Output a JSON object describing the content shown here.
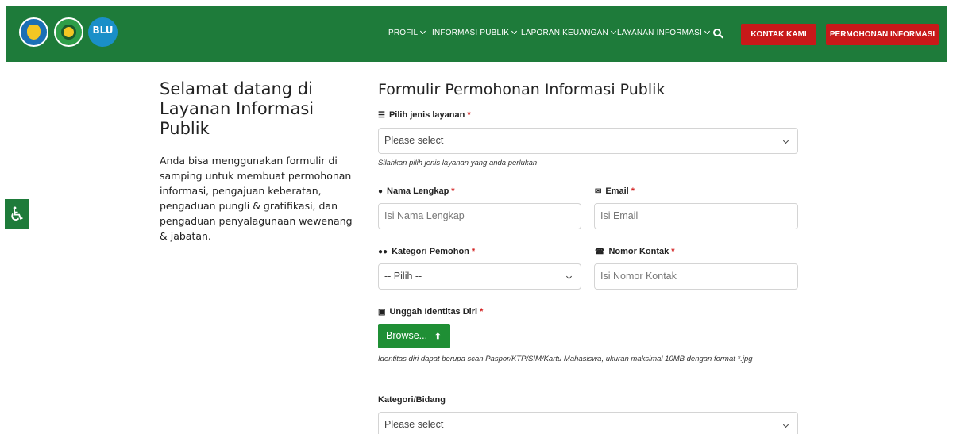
{
  "header": {
    "logos": [
      {
        "name": "kemendikbud-logo"
      },
      {
        "name": "institution-logo"
      },
      {
        "name": "blu-logo",
        "text": "BLU"
      }
    ],
    "nav": [
      {
        "label": "PROFIL"
      },
      {
        "label": "INFORMASI PUBLIK"
      },
      {
        "label": "LAPORAN KEUANGAN"
      },
      {
        "label": "LAYANAN INFORMASI"
      }
    ],
    "search_icon": "search-icon",
    "buttons": {
      "kontak": "KONTAK KAMI",
      "permohonan": "PERMOHONAN INFORMASI"
    },
    "brand_color": "#1e7b3a",
    "accent_color": "#c81919"
  },
  "accessibility": {
    "icon": "wheelchair-icon",
    "glyph": "♿"
  },
  "intro": {
    "title": "Selamat datang di Layanan Informasi Publik",
    "text": "Anda bisa menggunakan formulir di samping untuk membuat permohonan informasi, pengajuan keberatan, pengaduan pungli & gratifikasi, dan pengaduan penyalagunaan wewenang & jabatan."
  },
  "form": {
    "title": "Formulir Permohonan Informasi Publik",
    "required_mark": "*",
    "jenis_layanan": {
      "label": "Pilih jenis layanan",
      "icon": "database-icon",
      "value": "Please select",
      "help": "Silahkan pilih jenis layanan yang anda perlukan"
    },
    "nama": {
      "label": "Nama Lengkap",
      "icon": "user-icon",
      "placeholder": "Isi Nama Lengkap"
    },
    "email": {
      "label": "Email",
      "icon": "envelope-icon",
      "placeholder": "Isi Email"
    },
    "kategori_pemohon": {
      "label": "Kategori Pemohon",
      "icon": "users-icon",
      "value": "-- Pilih --"
    },
    "nomor_kontak": {
      "label": "Nomor Kontak",
      "icon": "phone-icon",
      "placeholder": "Isi Nomor Kontak"
    },
    "identitas": {
      "label": "Unggah Identitas Diri",
      "icon": "id-card-icon",
      "button": "Browse...",
      "help": "Identitas diri dapat berupa scan Paspor/KTP/SIM/Kartu Mahasiswa, ukuran maksimal 10MB dengan format *.jpg"
    },
    "kategori_bidang": {
      "label": "Kategori/Bidang",
      "value": "Please select"
    }
  }
}
